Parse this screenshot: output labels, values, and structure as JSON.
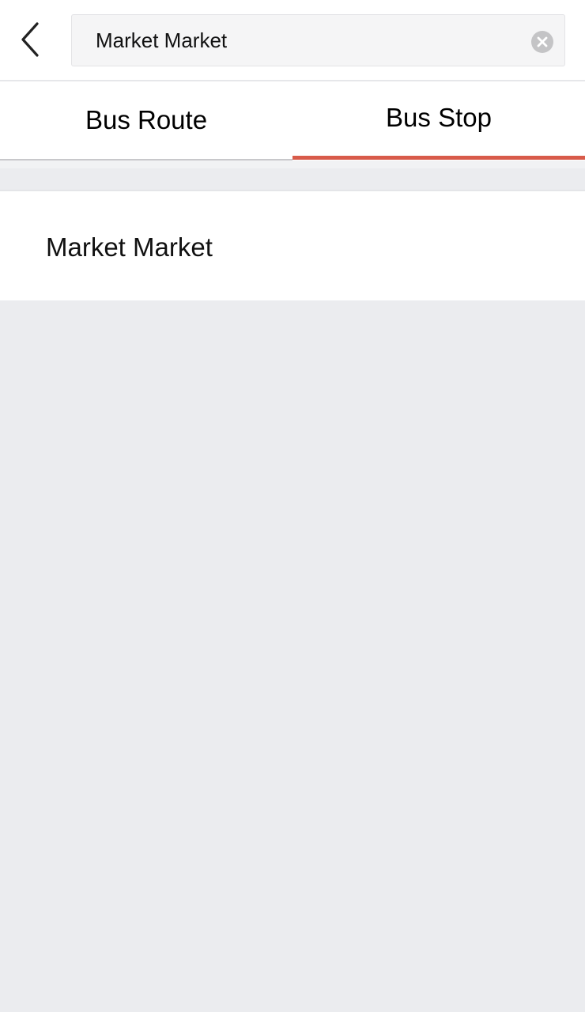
{
  "header": {
    "back_icon": "chevron-left-icon",
    "search": {
      "value": "Market Market",
      "placeholder": ""
    },
    "clear_icon": "clear-circle-icon"
  },
  "tabs": [
    {
      "label": "Bus Route",
      "active": false
    },
    {
      "label": "Bus Stop",
      "active": true
    }
  ],
  "colors": {
    "accent": "#d85b4a",
    "background": "#ebecef",
    "surface": "#ffffff"
  },
  "results": [
    {
      "label": "Market Market"
    }
  ]
}
